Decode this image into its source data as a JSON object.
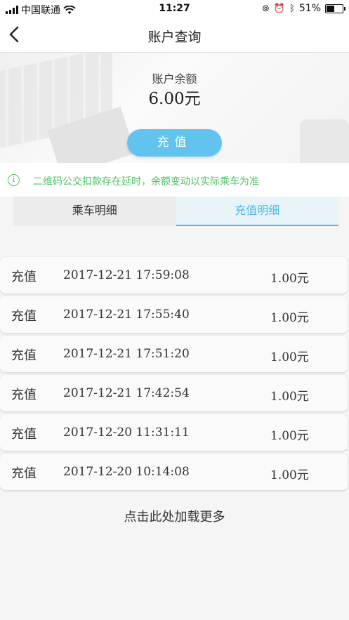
{
  "status_bar": {
    "carrier": "中国联通",
    "time": "11:27",
    "battery": "51%",
    "battery_level": 0.51
  },
  "nav": {
    "title": "账户查询"
  },
  "balance": {
    "label": "账户余额",
    "value": "6.00元",
    "recharge_button": "充值"
  },
  "notice": "二维码公交扣款存在延时，余额变动以实际乘车为准",
  "tabs": [
    {
      "label": "乘车明细",
      "active": false
    },
    {
      "label": "充值明细",
      "active": true
    }
  ],
  "records": [
    {
      "type": "充值",
      "time": "2017-12-21 17:59:08",
      "amount": "1.00元"
    },
    {
      "type": "充值",
      "time": "2017-12-21 17:55:40",
      "amount": "1.00元"
    },
    {
      "type": "充值",
      "time": "2017-12-21 17:51:20",
      "amount": "1.00元"
    },
    {
      "type": "充值",
      "time": "2017-12-21 17:42:54",
      "amount": "1.00元"
    },
    {
      "type": "充值",
      "time": "2017-12-20 11:31:11",
      "amount": "1.00元"
    },
    {
      "type": "充值",
      "time": "2017-12-20 10:14:08",
      "amount": "1.00元"
    }
  ],
  "load_more": "点击此处加载更多",
  "colors": {
    "accent": "#62c4ee",
    "tab_active": "#4db9e6",
    "notice_green": "#4cc264"
  }
}
